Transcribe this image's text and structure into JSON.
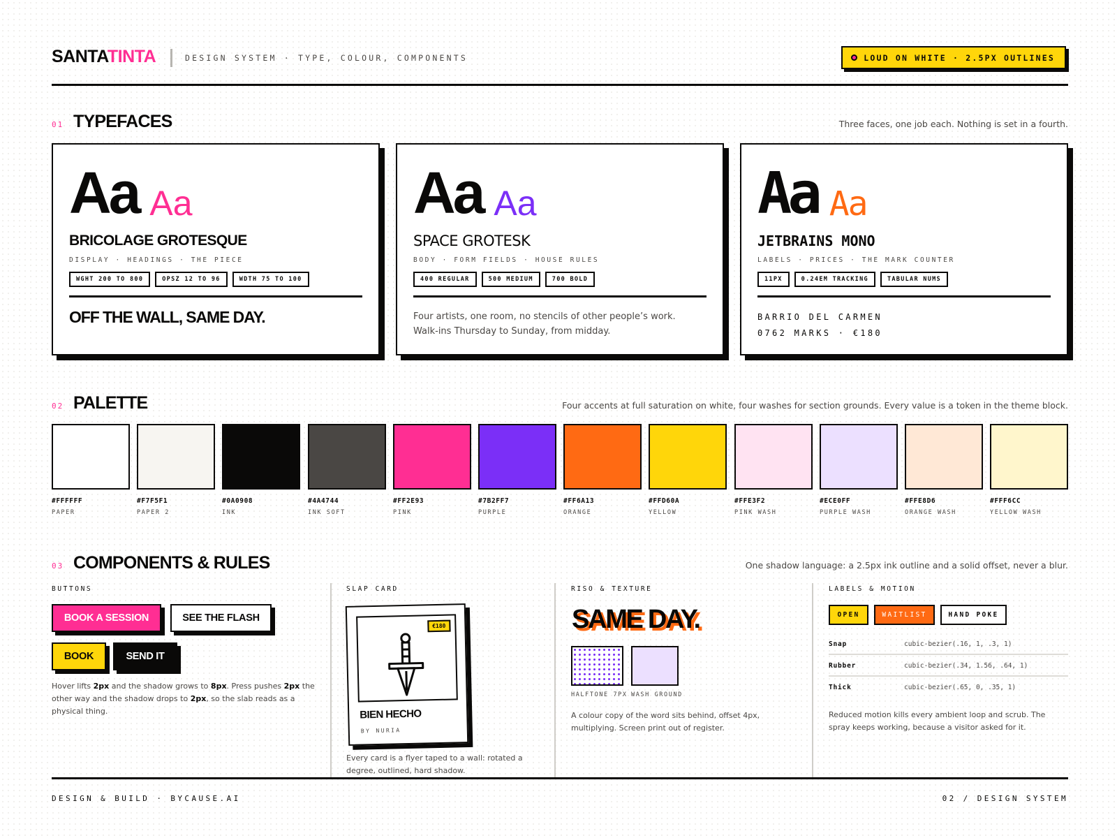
{
  "header": {
    "brand_a": "SANTA",
    "brand_b": "TINTA",
    "tagline": "DESIGN SYSTEM · TYPE, COLOUR, COMPONENTS",
    "badge": "LOUD ON WHITE · 2.5PX OUTLINES"
  },
  "sections": {
    "typefaces": {
      "num": "01",
      "title": "TYPEFACES",
      "note": "Three faces, one job each. Nothing is set in a fourth."
    },
    "palette": {
      "num": "02",
      "title": "PALETTE",
      "note": "Four accents at full saturation on white, four washes for section grounds. Every value is a token in the theme block."
    },
    "components": {
      "num": "03",
      "title": "COMPONENTS & RULES",
      "note": "One shadow language: a 2.5px ink outline and a solid offset, never a blur."
    }
  },
  "typefaces": [
    {
      "big": "Aa",
      "small": "Aa",
      "accent": "#FF2E93",
      "name": "BRICOLAGE GROTESQUE",
      "roles": "DISPLAY · HEADINGS · THE PIECE",
      "chips": [
        "WGHT 200 TO 800",
        "OPSZ 12 TO 96",
        "WDTH 75 TO 100"
      ],
      "sample": "OFF THE WALL, SAME DAY."
    },
    {
      "big": "Aa",
      "small": "Aa",
      "accent": "#7B2FF7",
      "name": "SPACE GROTESK",
      "roles": "BODY · FORM FIELDS · HOUSE RULES",
      "chips": [
        "400 REGULAR",
        "500 MEDIUM",
        "700 BOLD"
      ],
      "sample_line1": "Four artists, one room, no stencils of other people’s work.",
      "sample_line2": "Walk-ins Thursday to Sunday, from midday."
    },
    {
      "big": "Aa",
      "small": "Aa",
      "accent": "#FF6A13",
      "name": "JETBRAINS MONO",
      "roles": "LABELS · PRICES · THE MARK COUNTER",
      "chips": [
        "11PX",
        "0.24EM TRACKING",
        "TABULAR NUMS"
      ],
      "sample_line1": "BARRIO DEL CARMEN",
      "sample_line2": "0762 MARKS · €180"
    }
  ],
  "palette": [
    {
      "hex": "#FFFFFF",
      "name": "PAPER"
    },
    {
      "hex": "#F7F5F1",
      "name": "PAPER 2"
    },
    {
      "hex": "#0A0908",
      "name": "INK"
    },
    {
      "hex": "#4A4744",
      "name": "INK SOFT"
    },
    {
      "hex": "#FF2E93",
      "name": "PINK"
    },
    {
      "hex": "#7B2FF7",
      "name": "PURPLE"
    },
    {
      "hex": "#FF6A13",
      "name": "ORANGE"
    },
    {
      "hex": "#FFD60A",
      "name": "YELLOW"
    },
    {
      "hex": "#FFE3F2",
      "name": "PINK WASH"
    },
    {
      "hex": "#ECE0FF",
      "name": "PURPLE WASH"
    },
    {
      "hex": "#FFE8D6",
      "name": "ORANGE WASH"
    },
    {
      "hex": "#FFF6CC",
      "name": "YELLOW WASH"
    }
  ],
  "components": {
    "buttons": {
      "label": "BUTTONS",
      "book_session": "BOOK A SESSION",
      "see_flash": "SEE THE FLASH",
      "book": "BOOK",
      "send_it": "SEND IT",
      "desc": [
        "Hover lifts ",
        "2px",
        " and the shadow grows to ",
        "8px",
        ". Press pushes ",
        "2px",
        " the other way and the shadow drops to ",
        "2px",
        ", so the slab reads as a physical thing."
      ]
    },
    "slap_card": {
      "label": "SLAP CARD",
      "price": "€180",
      "title": "BIEN HECHO",
      "by": "BY NURIA",
      "desc": "Every card is a flyer taped to a wall: rotated a degree, outlined, hard shadow."
    },
    "riso": {
      "label": "RISO & TEXTURE",
      "word": "SAME DAY.",
      "halftone": "HALFTONE 7PX",
      "wash": "WASH GROUND",
      "desc": "A colour copy of the word sits behind, offset 4px, multiplying. Screen print out of register."
    },
    "labels": {
      "label": "LABELS & MOTION",
      "tags": [
        "OPEN",
        "WAITLIST",
        "HAND POKE"
      ],
      "motion": [
        {
          "name": "Snap",
          "value": "cubic-bezier(.16, 1, .3, 1)"
        },
        {
          "name": "Rubber",
          "value": "cubic-bezier(.34, 1.56, .64, 1)"
        },
        {
          "name": "Thick",
          "value": "cubic-bezier(.65, 0, .35, 1)"
        }
      ],
      "desc": "Reduced motion kills every ambient loop and scrub. The spray keeps working, because a visitor asked for it."
    }
  },
  "footer": {
    "left": "DESIGN & BUILD · BYCAUSE.AI",
    "right": "02 / DESIGN SYSTEM"
  }
}
